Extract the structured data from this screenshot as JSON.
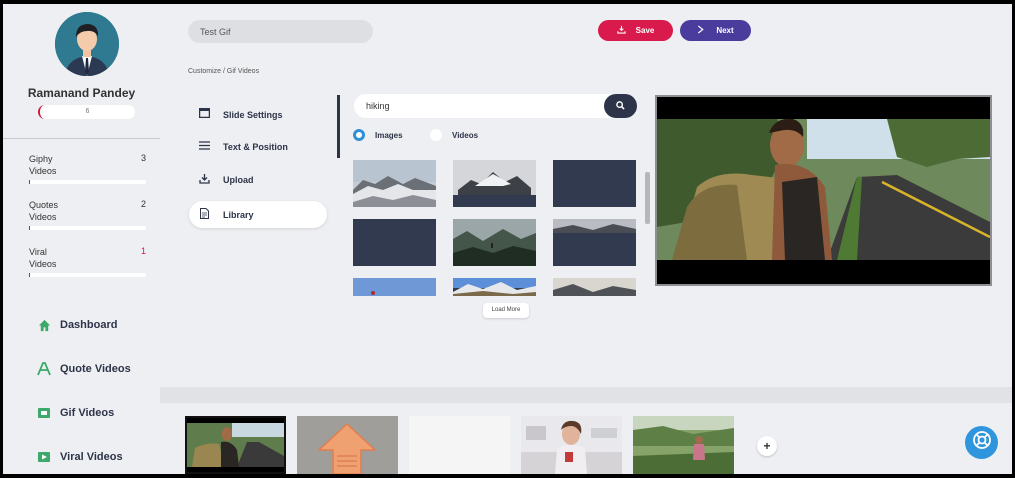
{
  "user": {
    "name": "Ramanand Pandey",
    "credits": "6"
  },
  "stats": [
    {
      "label": "Giphy Videos",
      "count": "3",
      "count_color": "#333333"
    },
    {
      "label": "Quotes Videos",
      "count": "2",
      "count_color": "#333333"
    },
    {
      "label": "Viral Videos",
      "count": "1",
      "count_color": "#d4173a"
    }
  ],
  "nav": {
    "dashboard": "Dashboard",
    "quote_videos": "Quote Videos",
    "gif_videos": "Gif Videos",
    "viral_videos": "Viral Videos"
  },
  "project": {
    "title": "Test Gif"
  },
  "toolbar": {
    "save_label": "Save",
    "next_label": "Next"
  },
  "breadcrumb": "Customize  /  Gif Videos",
  "settings_menu": {
    "slide_settings": "Slide Settings",
    "text_position": "Text & Position",
    "upload": "Upload",
    "library": "Library"
  },
  "search": {
    "query": "hiking"
  },
  "media_type": {
    "images": "Images",
    "videos": "Videos",
    "selected": "Images"
  },
  "library": {
    "load_more": "Load More"
  },
  "colors": {
    "accent_red": "#d81b4c",
    "accent_purple": "#4a3c9d",
    "navy": "#2d3348",
    "nav_icon_green": "#3ca86a",
    "help_blue": "#2f95dc"
  },
  "icons": {
    "save": "download-icon",
    "next": "chevron-right-icon",
    "search": "search-icon",
    "help": "lifebuoy-icon",
    "add": "plus-icon"
  }
}
